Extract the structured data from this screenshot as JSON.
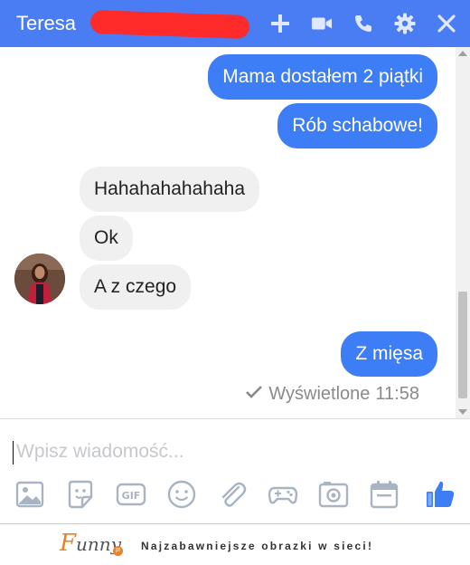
{
  "header": {
    "contact_name": "Teresa",
    "background_color": "#4a7cf3",
    "actions": [
      "plus-icon",
      "video-camera-icon",
      "phone-icon",
      "gear-icon",
      "close-icon"
    ]
  },
  "messages": [
    {
      "direction": "outgoing",
      "text": "Mama dostałem 2 piątki"
    },
    {
      "direction": "outgoing",
      "text": "Rób schabowe!"
    },
    {
      "direction": "incoming",
      "text": "Hahahahahahaha"
    },
    {
      "direction": "incoming",
      "text": "Ok"
    },
    {
      "direction": "incoming",
      "text": "A z czego"
    },
    {
      "direction": "outgoing",
      "text": "Z mięsa"
    }
  ],
  "seen_status": {
    "label": "Wyświetlone",
    "time": "11:58"
  },
  "composer": {
    "placeholder": "Wpisz wiadomość...",
    "tools": [
      "image-icon",
      "sticker-icon",
      "gif-icon",
      "emoji-icon",
      "attachment-icon",
      "game-controller-icon",
      "camera-icon",
      "calendar-icon",
      "thumbs-up-icon"
    ]
  },
  "footer": {
    "brand": "unny",
    "brand_initial": "F",
    "brand_badge": "pl",
    "tagline": "Najzabawniejsze obrazki w sieci!"
  },
  "colors": {
    "outgoing_bubble": "#3d7df5",
    "incoming_bubble": "#f1f0f0",
    "like_button": "#3d7df5"
  }
}
